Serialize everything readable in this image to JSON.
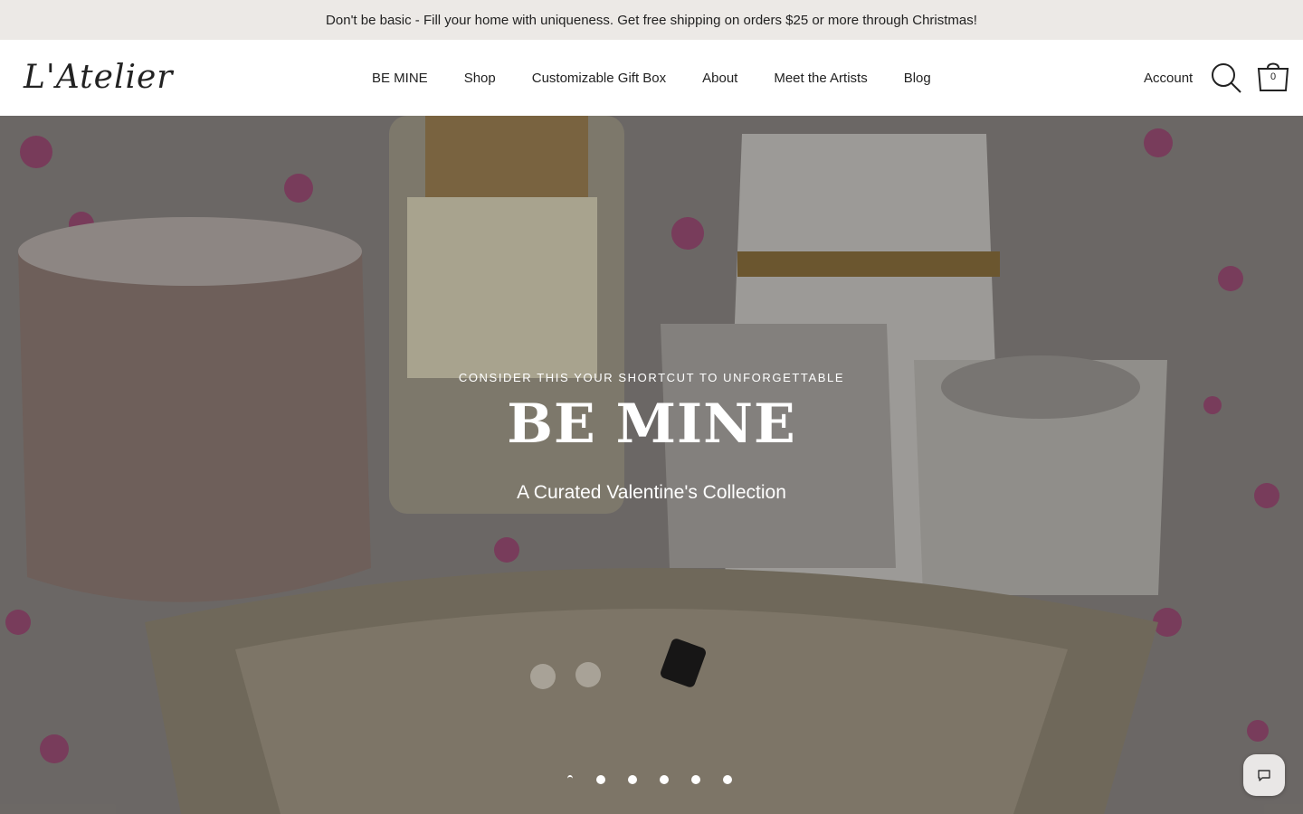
{
  "announcement": "Don't be basic - Fill your home with uniqueness. Get free shipping on orders $25 or more through Christmas!",
  "logo_text": "L'Atelier",
  "nav": {
    "items": [
      {
        "label": "BE MINE"
      },
      {
        "label": "Shop"
      },
      {
        "label": "Customizable Gift Box"
      },
      {
        "label": "About"
      },
      {
        "label": "Meet the Artists"
      },
      {
        "label": "Blog"
      }
    ]
  },
  "header_actions": {
    "account_label": "Account",
    "search_icon": "search-icon",
    "cart_icon": "cart-icon",
    "cart_count": "0"
  },
  "hero": {
    "eyebrow": "CONSIDER THIS YOUR SHORTCUT TO UNFORGETTABLE",
    "title": "BE MINE",
    "subtitle": "A Curated Valentine's Collection",
    "slides_count": 6,
    "active_slide": 1
  },
  "chat": {
    "icon": "chat-icon"
  },
  "colors": {
    "announcement_bg": "#ece9e6",
    "hero_text": "#ffffff"
  }
}
